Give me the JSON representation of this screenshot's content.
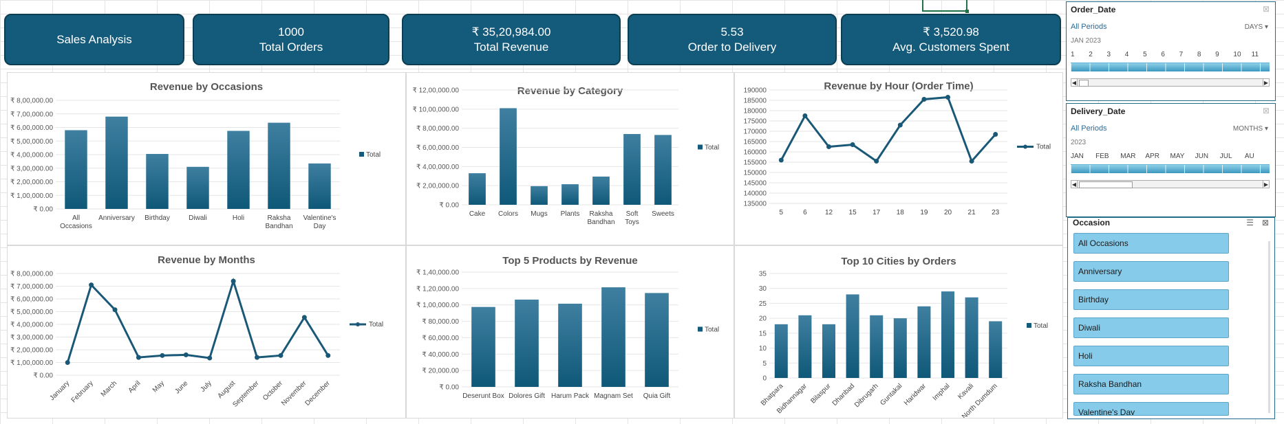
{
  "kpis": [
    {
      "title": "Sales Analysis"
    },
    {
      "value": "1000",
      "label": "Total Orders"
    },
    {
      "value": "₹ 35,20,984.00",
      "label": "Total Revenue"
    },
    {
      "value": "5.53",
      "label": "Order to Delivery"
    },
    {
      "value": "₹ 3,520.98",
      "label": "Avg. Customers Spent"
    }
  ],
  "colors": {
    "accent": "#145a7a",
    "bar_top": "#3f7fa0",
    "bar_bottom": "#0f5878",
    "slicer_item": "#86cbea"
  },
  "chart_data": [
    {
      "id": "occasions",
      "type": "bar",
      "title": "Revenue by Occasions",
      "categories": [
        "All Occasions",
        "Anniversary",
        "Birthday",
        "Diwali",
        "Holi",
        "Raksha Bandhan",
        "Valentine's Day"
      ],
      "series": [
        {
          "name": "Total",
          "values": [
            580000,
            680000,
            405000,
            310000,
            575000,
            635000,
            335000
          ]
        }
      ],
      "ylim": [
        0,
        800000
      ],
      "yticks": [
        0,
        100000,
        200000,
        300000,
        400000,
        500000,
        600000,
        700000,
        800000
      ],
      "ytick_labels": [
        "₹ 0.00",
        "₹ 1,00,000.00",
        "₹ 2,00,000.00",
        "₹ 3,00,000.00",
        "₹ 4,00,000.00",
        "₹ 5,00,000.00",
        "₹ 6,00,000.00",
        "₹ 7,00,000.00",
        "₹ 8,00,000.00"
      ],
      "legend": "right",
      "grid": true
    },
    {
      "id": "category",
      "type": "bar",
      "title": "Revenue by Category",
      "categories": [
        "Cake",
        "Colors",
        "Mugs",
        "Plants",
        "Raksha Bandhan",
        "Soft Toys",
        "Sweets"
      ],
      "series": [
        {
          "name": "Total",
          "values": [
            330000,
            1010000,
            195000,
            215000,
            295000,
            740000,
            730000
          ]
        }
      ],
      "ylim": [
        0,
        1200000
      ],
      "yticks": [
        0,
        200000,
        400000,
        600000,
        800000,
        1000000,
        1200000
      ],
      "ytick_labels": [
        "₹ 0.00",
        "₹ 2,00,000.00",
        "₹ 4,00,000.00",
        "₹ 6,00,000.00",
        "₹ 8,00,000.00",
        "₹ 10,00,000.00",
        "₹ 12,00,000.00"
      ],
      "legend": "right",
      "grid": true
    },
    {
      "id": "hour",
      "type": "line",
      "title": "Revenue by Hour (Order Time)",
      "categories": [
        "5",
        "6",
        "12",
        "15",
        "17",
        "18",
        "19",
        "20",
        "21",
        "23"
      ],
      "series": [
        {
          "name": "Total",
          "values": [
            156000,
            177500,
            162500,
            163500,
            155500,
            173000,
            185500,
            186500,
            155500,
            168500
          ]
        }
      ],
      "ylim": [
        135000,
        190000
      ],
      "yticks": [
        135000,
        140000,
        145000,
        150000,
        155000,
        160000,
        165000,
        170000,
        175000,
        180000,
        185000,
        190000
      ],
      "ytick_labels": [
        "135000",
        "140000",
        "145000",
        "150000",
        "155000",
        "160000",
        "165000",
        "170000",
        "175000",
        "180000",
        "185000",
        "190000"
      ],
      "legend": "right",
      "grid": true
    },
    {
      "id": "months",
      "type": "line",
      "title": "Revenue by Months",
      "categories": [
        "January",
        "February",
        "March",
        "April",
        "May",
        "June",
        "July",
        "August",
        "September",
        "October",
        "November",
        "December"
      ],
      "series": [
        {
          "name": "Total",
          "values": [
            100000,
            710000,
            515000,
            140000,
            155000,
            160000,
            135000,
            740000,
            140000,
            155000,
            455000,
            155000
          ]
        }
      ],
      "ylim": [
        0,
        800000
      ],
      "yticks": [
        0,
        100000,
        200000,
        300000,
        400000,
        500000,
        600000,
        700000,
        800000
      ],
      "ytick_labels": [
        "₹ 0.00",
        "₹ 1,00,000.00",
        "₹ 2,00,000.00",
        "₹ 3,00,000.00",
        "₹ 4,00,000.00",
        "₹ 5,00,000.00",
        "₹ 6,00,000.00",
        "₹ 7,00,000.00",
        "₹ 8,00,000.00"
      ],
      "legend": "right",
      "grid": true,
      "rotate_labels": true
    },
    {
      "id": "products",
      "type": "bar",
      "title": "Top 5 Products by Revenue",
      "categories": [
        "Deserunt Box",
        "Dolores Gift",
        "Harum Pack",
        "Magnam Set",
        "Quia Gift"
      ],
      "series": [
        {
          "name": "Total",
          "values": [
            97500,
            106500,
            101500,
            121500,
            114500
          ]
        }
      ],
      "ylim": [
        0,
        140000
      ],
      "yticks": [
        0,
        20000,
        40000,
        60000,
        80000,
        100000,
        120000,
        140000
      ],
      "ytick_labels": [
        "₹ 0.00",
        "₹ 20,000.00",
        "₹ 40,000.00",
        "₹ 60,000.00",
        "₹ 80,000.00",
        "₹ 1,00,000.00",
        "₹ 1,20,000.00",
        "₹ 1,40,000.00"
      ],
      "legend": "right",
      "grid": true
    },
    {
      "id": "cities",
      "type": "bar",
      "title": "Top 10 Cities by Orders",
      "categories": [
        "Bhatpara",
        "Bidhannagar",
        "Bilaspur",
        "Dhanbad",
        "Dibrugarh",
        "Guntakal",
        "Haridwar",
        "Imphal",
        "Kavali",
        "North Dumdum"
      ],
      "series": [
        {
          "name": "Total",
          "values": [
            18,
            21,
            18,
            28,
            21,
            20,
            24,
            29,
            27,
            19
          ]
        }
      ],
      "ylim": [
        0,
        35
      ],
      "yticks": [
        0,
        5,
        10,
        15,
        20,
        25,
        30,
        35
      ],
      "ytick_labels": [
        "0",
        "5",
        "10",
        "15",
        "20",
        "25",
        "30",
        "35"
      ],
      "legend": "right",
      "grid": true,
      "rotate_labels": true
    }
  ],
  "order_date_slicer": {
    "title": "Order_Date",
    "period": "All Periods",
    "level": "DAYS ▾",
    "month_label": "JAN 2023",
    "ticks": [
      "1",
      "2",
      "3",
      "4",
      "5",
      "6",
      "7",
      "8",
      "9",
      "10",
      "11"
    ]
  },
  "delivery_date_slicer": {
    "title": "Delivery_Date",
    "period": "All Periods",
    "level": "MONTHS ▾",
    "year_label": "2023",
    "ticks": [
      "JAN",
      "FEB",
      "MAR",
      "APR",
      "MAY",
      "JUN",
      "JUL",
      "AU"
    ]
  },
  "occasion_slicer": {
    "title": "Occasion",
    "items": [
      "All Occasions",
      "Anniversary",
      "Birthday",
      "Diwali",
      "Holi",
      "Raksha Bandhan",
      "Valentine's Day"
    ]
  }
}
